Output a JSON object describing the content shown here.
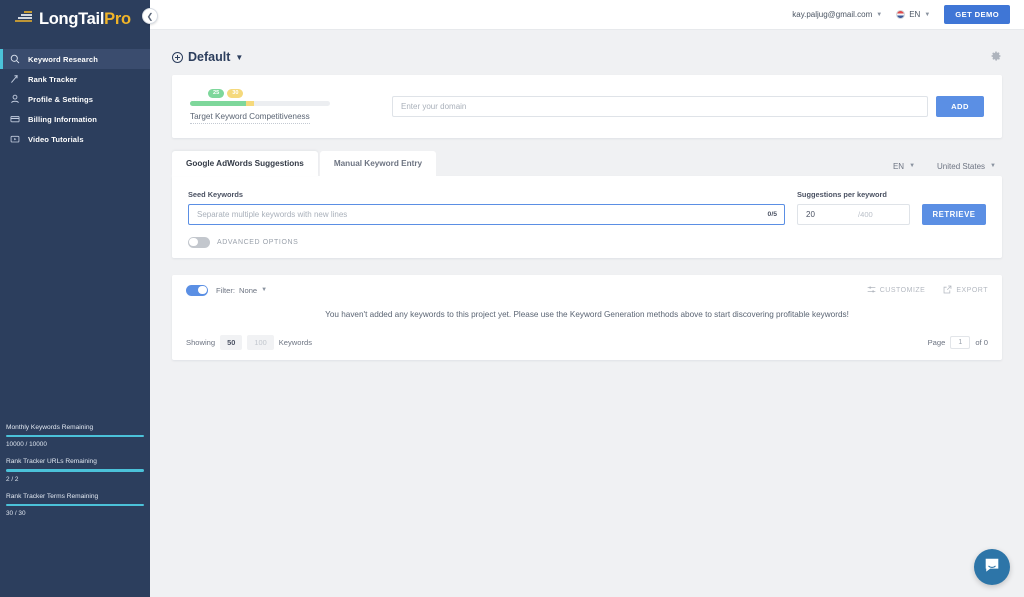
{
  "brand": {
    "part1": "Long",
    "part2": "Tail",
    "part3": "Pro",
    "collapse_icon": "chevron-left-icon"
  },
  "sidebar": {
    "items": [
      {
        "label": "Keyword Research",
        "icon": "search-icon",
        "active": true
      },
      {
        "label": "Rank Tracker",
        "icon": "trending-up-icon",
        "active": false
      },
      {
        "label": "Profile & Settings",
        "icon": "user-icon",
        "active": false
      },
      {
        "label": "Billing Information",
        "icon": "credit-card-icon",
        "active": false
      },
      {
        "label": "Video Tutorials",
        "icon": "video-icon",
        "active": false
      }
    ],
    "meters": [
      {
        "title": "Monthly Keywords Remaining",
        "value": "10000 / 10000",
        "percent": 100
      },
      {
        "title": "Rank Tracker URLs Remaining",
        "value": "2 / 2",
        "percent": 100
      },
      {
        "title": "Rank Tracker Terms Remaining",
        "value": "30 / 30",
        "percent": 100
      }
    ],
    "accent_color": "#4bc2d9",
    "background_color": "#2c3e5d"
  },
  "topbar": {
    "email": "kay.paljug@gmail.com",
    "email_caret": "caret-down-icon",
    "language": "EN",
    "language_caret": "caret-down-icon",
    "flag_icon": "us-flag-icon",
    "demo_button": "GET DEMO",
    "demo_color": "#3f76d6"
  },
  "page": {
    "project_title": "Default",
    "project_caret": "caret-down-icon",
    "add_project_icon": "plus-circle-icon",
    "settings_icon": "gear-icon"
  },
  "domain_card": {
    "competitiveness": {
      "badge_low": "25",
      "badge_high": "30",
      "label": "Target Keyword Competitiveness",
      "green_color": "#7ed79b",
      "amber_color": "#f5d97c"
    },
    "domain_placeholder": "Enter your domain",
    "domain_value": "",
    "add_button": "ADD"
  },
  "tabs": [
    {
      "label": "Google AdWords Suggestions",
      "active": true
    },
    {
      "label": "Manual Keyword Entry",
      "active": false
    }
  ],
  "locales": [
    {
      "label": "EN",
      "caret": "caret-down-icon"
    },
    {
      "label": "United States",
      "caret": "caret-down-icon"
    }
  ],
  "keyword_form": {
    "seed_label": "Seed Keywords",
    "seed_placeholder": "Separate multiple keywords with new lines",
    "seed_value": "",
    "seed_counter": "0/5",
    "suggestions_label": "Suggestions per keyword",
    "suggestions_value": "20",
    "suggestions_max": "/400",
    "retrieve_button": "RETRIEVE",
    "advanced_label": "ADVANCED OPTIONS",
    "advanced_on": false
  },
  "results": {
    "filter_toggle_on": true,
    "filter_prefix": "Filter:",
    "filter_value": "None",
    "filter_caret": "caret-down-icon",
    "customize_label": "CUSTOMIZE",
    "customize_icon": "sliders-icon",
    "export_label": "EXPORT",
    "export_icon": "external-link-icon",
    "empty_message": "You haven't added any keywords to this project yet. Please use the Keyword Generation methods above to start discovering profitable keywords!",
    "showing_label": "Showing",
    "page_size_selected": "50",
    "page_size_other": "100",
    "keywords_label": "Keywords",
    "page_label": "Page",
    "page_value": "1",
    "page_of": "of 0"
  },
  "chat": {
    "icon": "chat-bubble-icon",
    "color": "#2d75a8"
  }
}
